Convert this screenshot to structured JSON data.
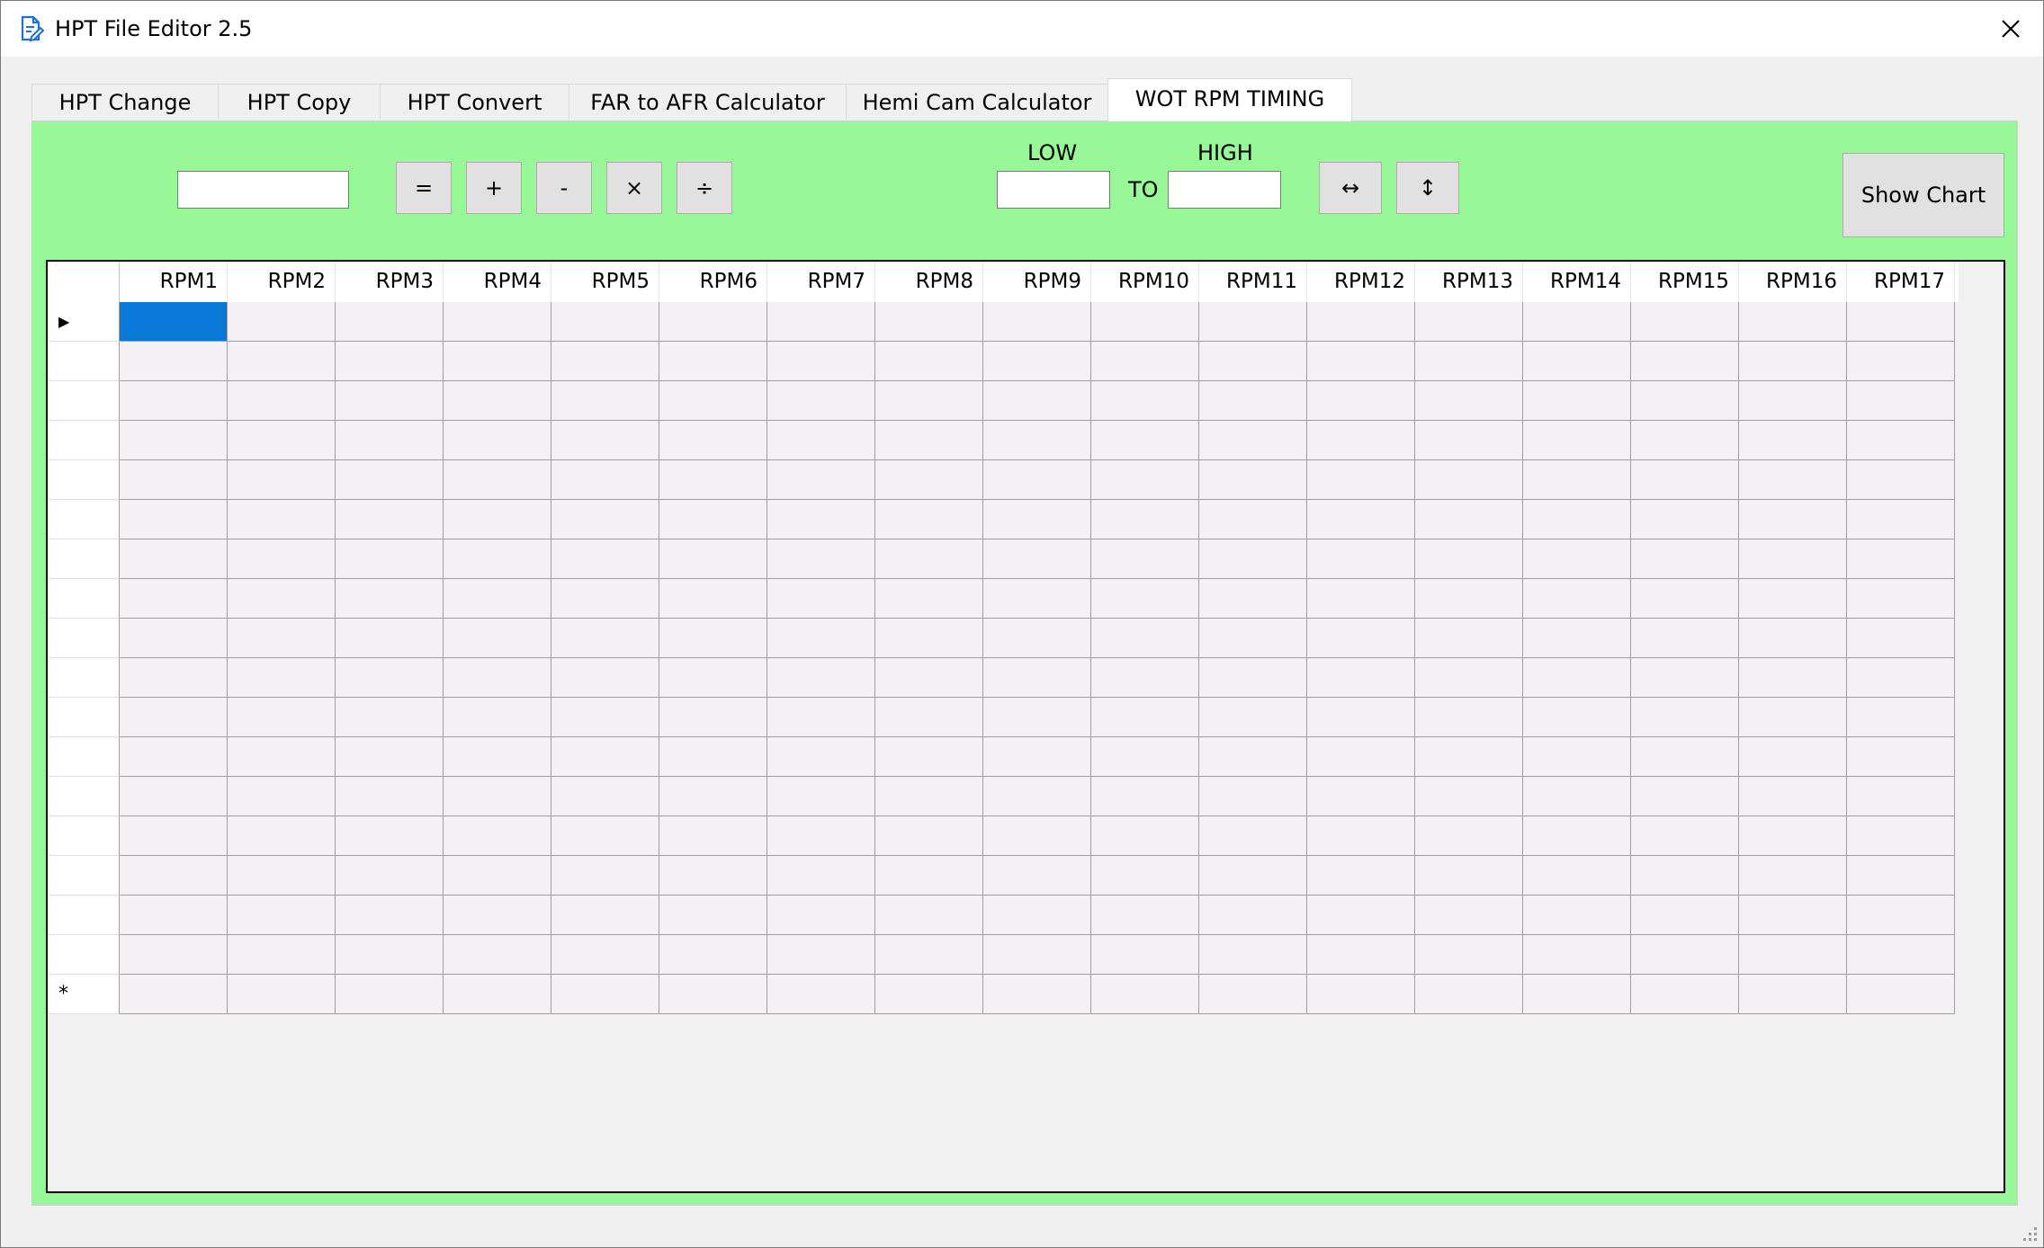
{
  "window": {
    "title": "HPT File Editor 2.5"
  },
  "tabs": [
    {
      "label": "HPT Change"
    },
    {
      "label": "HPT Copy"
    },
    {
      "label": "HPT Convert"
    },
    {
      "label": "FAR to AFR Calculator"
    },
    {
      "label": "Hemi Cam Calculator"
    },
    {
      "label": "WOT RPM TIMING",
      "active": true
    }
  ],
  "toolbar": {
    "value_input": "",
    "ops": [
      {
        "label": "="
      },
      {
        "label": "+"
      },
      {
        "label": "-"
      },
      {
        "label": "×"
      },
      {
        "label": "÷"
      }
    ],
    "low_label": "LOW",
    "high_label": "HIGH",
    "to_label": "TO",
    "low_value": "",
    "high_value": "",
    "horizontal_label": "↔",
    "vertical_label": "↕",
    "show_chart_label": "Show Chart"
  },
  "grid": {
    "columns": [
      "RPM1",
      "RPM2",
      "RPM3",
      "RPM4",
      "RPM5",
      "RPM6",
      "RPM7",
      "RPM8",
      "RPM9",
      "RPM10",
      "RPM11",
      "RPM12",
      "RPM13",
      "RPM14",
      "RPM15",
      "RPM16",
      "RPM17"
    ],
    "row_count": 18,
    "current_row_marker": "▶",
    "new_row_marker": "*",
    "selected_cell": {
      "row": 0,
      "col": 0
    }
  },
  "colors": {
    "panel_bg": "#98f898",
    "cell_bg": "#f4f0f4",
    "selection": "#0a78d7"
  }
}
